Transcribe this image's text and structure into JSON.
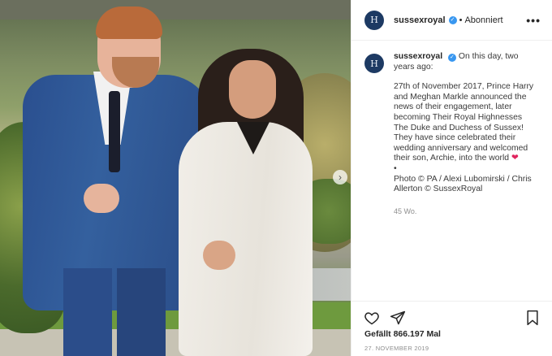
{
  "post": {
    "image_alt": "Prince Harry and Meghan Markle walking in a garden",
    "header": {
      "username": "sussexroyal",
      "separator": "•",
      "follow_status": "Abonniert",
      "more": "•••",
      "avatar_letter": "H"
    },
    "caption": {
      "username": "sussexroyal",
      "intro": "On this day, two years ago:",
      "lines": [
        "27th of November 2017, Prince Harry",
        "and Meghan Markle announced the",
        "news of their engagement, later",
        "becoming Their Royal Highnesses",
        "The Duke and Duchess of Sussex!",
        "They have since celebrated their",
        "wedding anniversary and welcomed",
        "their son, Archie, into the world"
      ],
      "heart": "❤",
      "bullet": "•",
      "credit_lines": [
        "Photo © PA / Alexi Lubomirski / Chris",
        "Allerton © SussexRoyal"
      ],
      "age": "45 Wo."
    },
    "likes": "Gefällt 866.197 Mal",
    "date": "27. NOVEMBER 2019",
    "next_arrow": "›"
  },
  "colors": {
    "verified": "#3897f0",
    "heart": "#e0245e",
    "avatar": "#1d3a63"
  },
  "icons": [
    "heart-icon",
    "send-icon",
    "bookmark-icon",
    "verified-icon",
    "more-icon",
    "chevron-right-icon"
  ]
}
